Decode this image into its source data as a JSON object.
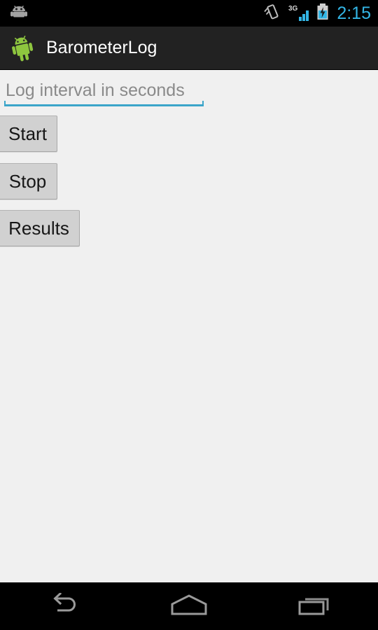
{
  "status_bar": {
    "notification_icon": "android-notification-icon",
    "vibrate_icon": "vibrate-icon",
    "signal_label": "3G",
    "signal_icon": "signal-bars-icon",
    "battery_icon": "battery-charging-icon",
    "time": "2:15",
    "time_color": "#33b5e5",
    "background": "#000000"
  },
  "action_bar": {
    "logo_icon": "android-robot-icon",
    "title": "BarometerLog",
    "background": "#222222",
    "title_color": "#ffffff"
  },
  "main": {
    "background": "#f0f0f0",
    "interval_input": {
      "value": "",
      "placeholder": "Log interval in seconds",
      "underline_color": "#3ba5c9"
    },
    "buttons": [
      {
        "name": "start",
        "label": "Start"
      },
      {
        "name": "stop",
        "label": "Stop"
      },
      {
        "name": "results",
        "label": "Results"
      }
    ],
    "button_fill": "#d1d1d1"
  },
  "nav_bar": {
    "background": "#000000",
    "items": [
      {
        "name": "back",
        "icon": "back-arrow-icon"
      },
      {
        "name": "home",
        "icon": "home-icon"
      },
      {
        "name": "recents",
        "icon": "recent-apps-icon"
      }
    ],
    "icon_color": "#9a9a9a"
  }
}
